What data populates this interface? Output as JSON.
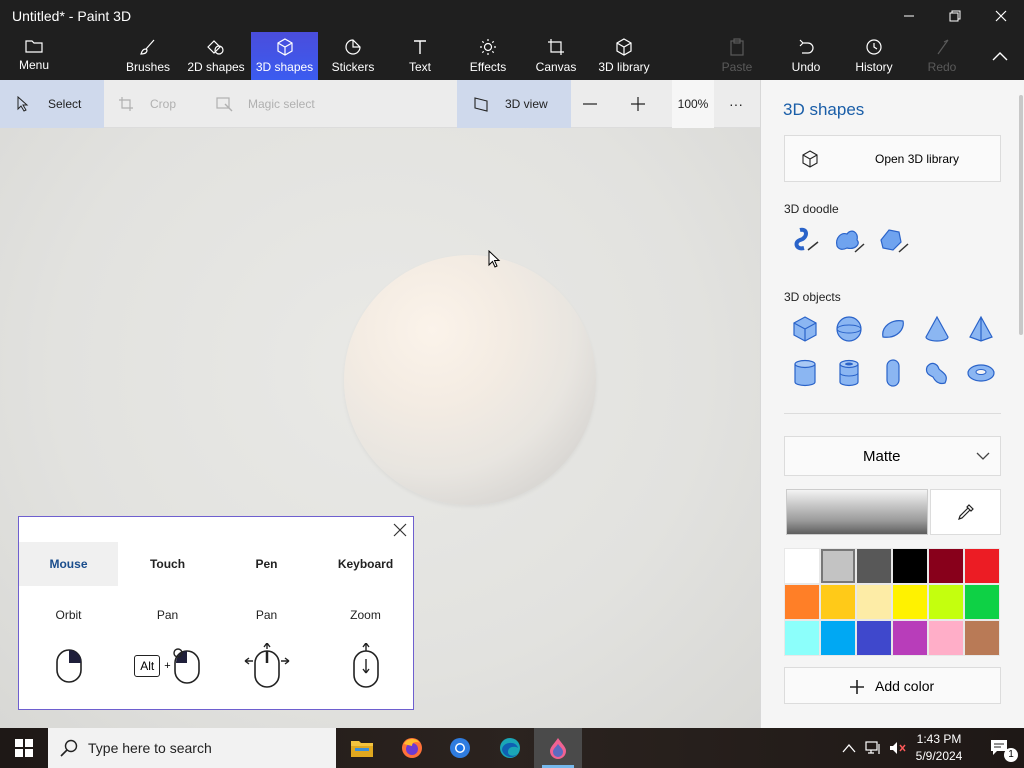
{
  "window": {
    "title": "Untitled* - Paint 3D"
  },
  "ribbon": {
    "menu_label": "Menu",
    "tools": [
      {
        "label": "Brushes"
      },
      {
        "label": "2D shapes"
      },
      {
        "label": "3D shapes"
      },
      {
        "label": "Stickers"
      },
      {
        "label": "Text"
      },
      {
        "label": "Effects"
      },
      {
        "label": "Canvas"
      },
      {
        "label": "3D library"
      }
    ],
    "actions": [
      {
        "label": "Paste"
      },
      {
        "label": "Undo"
      },
      {
        "label": "History"
      },
      {
        "label": "Redo"
      }
    ],
    "active_tool": "3D shapes"
  },
  "toolbar": {
    "select_label": "Select",
    "crop_label": "Crop",
    "magic_select_label": "Magic select",
    "view_label": "3D view",
    "zoom": "100%",
    "more": "···"
  },
  "help_panel": {
    "tabs": [
      {
        "label": "Mouse"
      },
      {
        "label": "Touch"
      },
      {
        "label": "Pen"
      },
      {
        "label": "Keyboard"
      }
    ],
    "actions": [
      {
        "label": "Orbit"
      },
      {
        "label": "Pan"
      },
      {
        "label": "Pan"
      },
      {
        "label": "Zoom"
      }
    ],
    "alt_key": "Alt",
    "plus": "+"
  },
  "side_panel": {
    "title": "3D shapes",
    "open_library_label": "Open 3D library",
    "doodle_section": "3D doodle",
    "objects_section": "3D objects",
    "material": "Matte",
    "add_color_label": "Add color",
    "colors": [
      "#ffffff",
      "#c3c3c3",
      "#585858",
      "#000000",
      "#88001b",
      "#ec1c24",
      "#ff7f27",
      "#ffca18",
      "#fdeca6",
      "#fff200",
      "#c4ff0e",
      "#0ed145",
      "#8cfffb",
      "#00a8f3",
      "#3f48cc",
      "#b83dba",
      "#ffaec8",
      "#b97a56"
    ],
    "selected_color_index": 1
  },
  "taskbar": {
    "search_placeholder": "Type here to search",
    "time": "1:43 PM",
    "date": "5/9/2024",
    "notification_count": "1"
  }
}
